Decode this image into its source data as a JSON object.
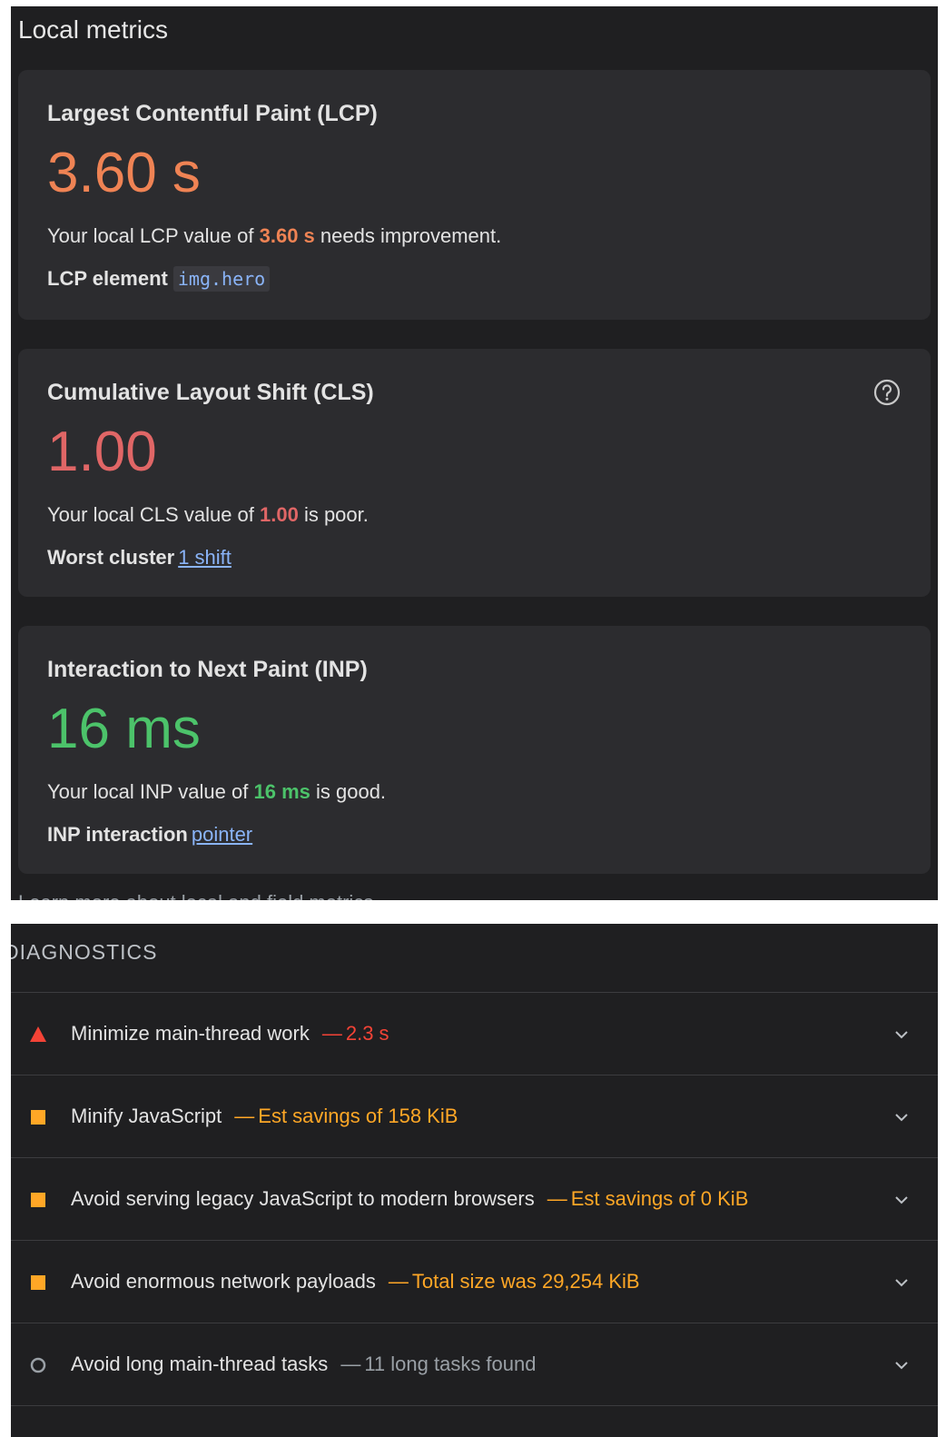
{
  "local_metrics": {
    "title": "Local metrics",
    "cards": [
      {
        "title": "Largest Contentful Paint (LCP)",
        "value": "3.60 s",
        "desc_prefix": "Your local LCP value of ",
        "desc_value": "3.60 s",
        "desc_suffix": " needs improvement.",
        "detail_label": "LCP element",
        "detail_value": "img.hero",
        "color": "#ef8354"
      },
      {
        "title": "Cumulative Layout Shift (CLS)",
        "value": "1.00",
        "desc_prefix": "Your local CLS value of ",
        "desc_value": "1.00",
        "desc_suffix": " is poor.",
        "detail_label": "Worst cluster",
        "detail_value": "1 shift",
        "color": "#e06666"
      },
      {
        "title": "Interaction to Next Paint (INP)",
        "value": "16 ms",
        "desc_prefix": "Your local INP value of ",
        "desc_value": "16 ms",
        "desc_suffix": " is good.",
        "detail_label": "INP interaction",
        "detail_value": "pointer",
        "color": "#4cc36a"
      }
    ],
    "cut_off_text": "Learn more about local and field metrics"
  },
  "diagnostics": {
    "heading": "DIAGNOSTICS",
    "items": [
      {
        "label": "Minimize main-thread work",
        "separator": "—",
        "detail": "2.3 s",
        "severity": "fail",
        "detail_color": "#f44336"
      },
      {
        "label": "Minify JavaScript",
        "separator": "—",
        "detail": "Est savings of 158 KiB",
        "severity": "average",
        "detail_color": "#ffa726"
      },
      {
        "label": "Avoid serving legacy JavaScript to modern browsers",
        "separator": "—",
        "detail": "Est savings of 0 KiB",
        "severity": "average",
        "detail_color": "#ffa726"
      },
      {
        "label": "Avoid enormous network payloads",
        "separator": "—",
        "detail": "Total size was 29,254 KiB",
        "severity": "average",
        "detail_color": "#ffa726"
      },
      {
        "label": "Avoid long main-thread tasks",
        "separator": "—",
        "detail": "11 long tasks found",
        "severity": "info",
        "detail_color": "#9aa0a6"
      }
    ]
  },
  "colors": {
    "panel_bg": "#1f1f21",
    "card_bg": "#2c2c2f",
    "link": "#8ab4f8",
    "fail": "#f44336",
    "average": "#ffa726",
    "info": "#9aa0a6"
  },
  "icons": {
    "help": "help-circle-icon",
    "expand": "chevron-down-icon",
    "fail": "red-triangle-icon",
    "average": "orange-square-icon",
    "info": "gray-circle-icon"
  }
}
